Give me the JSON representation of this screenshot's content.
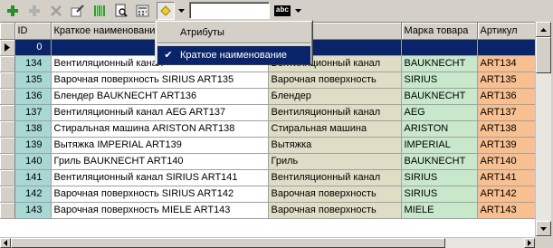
{
  "toolbar": {
    "buttons": [
      {
        "name": "add-icon",
        "color": "#2e8b2e"
      },
      {
        "name": "add-child-icon",
        "color": "#a0a0a0"
      },
      {
        "name": "delete-icon",
        "color": "#a0a0a0"
      },
      {
        "name": "edit-icon",
        "color": "#808080"
      },
      {
        "name": "barcode-icon",
        "color": "#2ea02e"
      },
      {
        "name": "preview-icon",
        "color": "#404040"
      },
      {
        "name": "calculator-icon",
        "color": "#808080"
      },
      {
        "name": "filter-icon",
        "color": "#e0c020"
      }
    ],
    "search": {
      "value": "",
      "placeholder": ""
    },
    "abc_label": "abc"
  },
  "menu": {
    "items": [
      {
        "label": "Атрибуты",
        "checked": false
      },
      {
        "label": "Краткое наименование",
        "checked": true
      }
    ]
  },
  "grid": {
    "columns": [
      "ID",
      "Краткое наименование",
      "Категория товара",
      "Марка товара",
      "Артикул"
    ],
    "header_partial": {
      "name": "Краткое наименовани",
      "cat": "ра",
      "art": "Артикул"
    },
    "rows": [
      {
        "id": "0",
        "name": "",
        "cat": "",
        "brand": "",
        "art": "",
        "selected": true
      },
      {
        "id": "134",
        "name": "Вентиляционный канал",
        "cat": "Вентиляционный канал",
        "brand": "BAUKNECHT",
        "art": "ART134"
      },
      {
        "id": "135",
        "name": "Варочная поверхность SIRIUS ART135",
        "cat": "Варочная поверхность",
        "brand": "SIRIUS",
        "art": "ART135"
      },
      {
        "id": "136",
        "name": "Блендер BAUKNECHT ART136",
        "cat": "Блендер",
        "brand": "BAUKNECHT",
        "art": "ART136"
      },
      {
        "id": "137",
        "name": "Вентиляционный канал AEG ART137",
        "cat": "Вентиляционный канал",
        "brand": "AEG",
        "art": "ART137"
      },
      {
        "id": "138",
        "name": "Стиральная машина ARISTON ART138",
        "cat": "Стиральная машина",
        "brand": "ARISTON",
        "art": "ART138"
      },
      {
        "id": "139",
        "name": "Вытяжка IMPERIAL ART139",
        "cat": "Вытяжка",
        "brand": "IMPERIAL",
        "art": "ART139"
      },
      {
        "id": "140",
        "name": "Гриль BAUKNECHT ART140",
        "cat": "Гриль",
        "brand": "BAUKNECHT",
        "art": "ART140"
      },
      {
        "id": "141",
        "name": "Вентиляционный канал SIRIUS ART141",
        "cat": "Вентиляционный канал",
        "brand": "SIRIUS",
        "art": "ART141"
      },
      {
        "id": "142",
        "name": "Варочная поверхность SIRIUS ART142",
        "cat": "Варочная поверхность",
        "brand": "SIRIUS",
        "art": "ART142"
      },
      {
        "id": "143",
        "name": "Варочная поверхность MIELE ART143",
        "cat": "Варочная поверхность",
        "brand": "MIELE",
        "art": "ART143"
      }
    ]
  },
  "colors": {
    "id_col": "#a8d8d4",
    "category_col": "#e0ddc6",
    "brand_col": "#c8e8cc",
    "article_col": "#f8c090",
    "selection": "#0a246a"
  }
}
